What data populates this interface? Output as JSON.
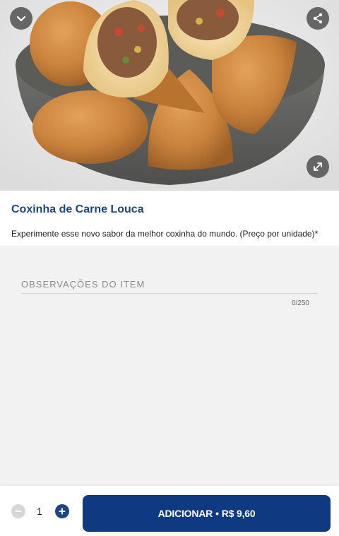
{
  "product": {
    "title": "Coxinha de Carne Louca",
    "description": "Experimente esse novo sabor da melhor coxinha do mundo. (Preço por unidade)*"
  },
  "notes": {
    "placeholder": "OBSERVAÇÕES DO ITEM",
    "value": "",
    "counter": "0/250"
  },
  "quantity": {
    "value": "1"
  },
  "add_button": {
    "label": "ADICIONAR",
    "separator": "•",
    "price": "R$ 9,60"
  },
  "icons": {
    "back": "chevron-down-icon",
    "share": "share-icon",
    "expand": "expand-icon",
    "minus": "minus-icon",
    "plus": "plus-icon"
  },
  "colors": {
    "brand": "#1c4587",
    "button": "#0f3a82"
  }
}
